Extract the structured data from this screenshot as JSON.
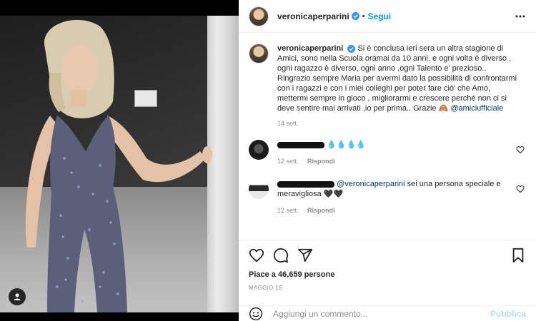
{
  "post": {
    "username": "veronicaperparini",
    "follow_label": "Segui",
    "separator": "•",
    "more_icon": "more-horizontal-icon",
    "verified_icon": "verified-badge-icon"
  },
  "caption": {
    "username": "veronicaperparini",
    "text": "Si è conclusa ieri sera un altra stagione di Amici, sono nella Scuola oramai da 10 anni, e ogni volta è diverso , ogni ragazzo è diverso, ogni anno ,ogni Talento e' prezioso.. Ringrazio sempre Maria per avermi dato la possibilità di confrontarmi con i ragazzi e con i miei colleghi per poter fare ciò' che Amo, mettermi sempre in gioco , migliorarmi e crescere perché non ci si deve sentire mai arrivati ,io per prima.. Grazie 🙈",
    "mention": "@amiciufficiale",
    "time": "14 sett."
  },
  "comments": [
    {
      "text": "💧💧💧💧",
      "time": "12 sett.",
      "reply_label": "Rispondi"
    },
    {
      "mention": "@veronicaperparini",
      "text": " sei una persona speciale e meravigliosa 🖤🖤",
      "time": "12 sett.",
      "reply_label": "Rispondi"
    }
  ],
  "actions": {
    "likes_text": "Piace a 46,659 persone",
    "date": "MAGGIO 16"
  },
  "add_comment": {
    "placeholder": "Aggiungi un commento...",
    "publish_label": "Pubblica"
  },
  "colors": {
    "link_blue": "#0095f6",
    "mention_blue": "#00376b",
    "publish_disabled": "#b2dffc"
  }
}
